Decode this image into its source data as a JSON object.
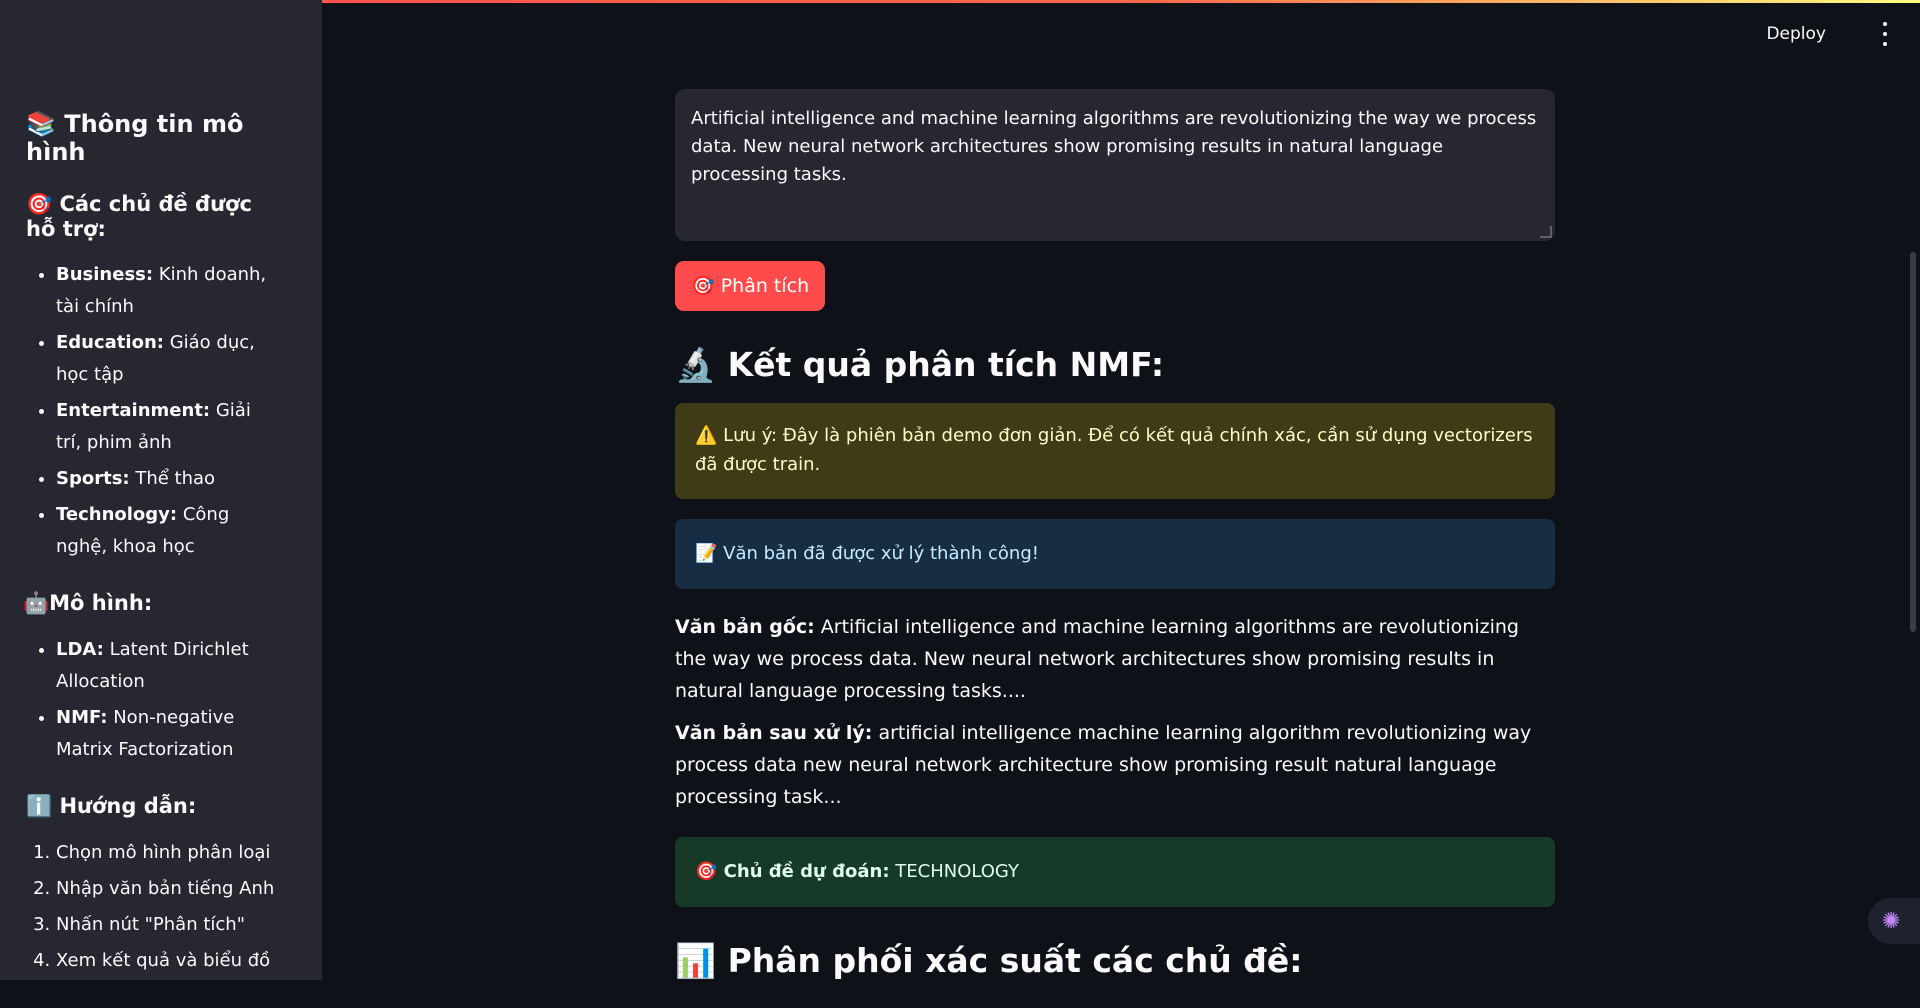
{
  "header": {
    "deploy_label": "Deploy"
  },
  "sidebar": {
    "info_title": "📚 Thông tin mô hình",
    "topics_title": "🎯 Các chủ đề được hỗ trợ:",
    "topics": [
      {
        "name": "Business:",
        "desc": " Kinh doanh, tài chính"
      },
      {
        "name": "Education:",
        "desc": " Giáo dục, học tập"
      },
      {
        "name": "Entertainment:",
        "desc": " Giải trí, phim ảnh"
      },
      {
        "name": "Sports:",
        "desc": " Thể thao"
      },
      {
        "name": "Technology:",
        "desc": " Công nghệ, khoa học"
      }
    ],
    "models_title": "🤖Mô hình:",
    "models": [
      {
        "name": "LDA:",
        "desc": " Latent Dirichlet Allocation"
      },
      {
        "name": "NMF:",
        "desc": " Non-negative Matrix Factorization"
      }
    ],
    "guide_title": "ℹ️ Hướng dẫn:",
    "guide": [
      "Chọn mô hình phân loại",
      "Nhập văn bản tiếng Anh",
      "Nhấn nút \"Phân tích\"",
      "Xem kết quả và biểu đồ"
    ]
  },
  "main": {
    "input_text": "Artificial intelligence and machine learning algorithms are revolutionizing the way we process data. New neural network architectures show promising results in natural language processing tasks.",
    "analyze_button": "🎯 Phân tích",
    "results_title": "🔬 Kết quả phân tích NMF:",
    "warning": "⚠️ Lưu ý: Đây là phiên bản demo đơn giản. Để có kết quả chính xác, cần sử dụng vectorizers đã được train.",
    "info": "📝 Văn bản đã được xử lý thành công!",
    "original_label": "Văn bản gốc:",
    "original_text": " Artificial intelligence and machine learning algorithms are revolutionizing the way we process data. New neural network architectures show promising results in natural language processing tasks....",
    "processed_label": "Văn bản sau xử lý:",
    "processed_text": " artificial intelligence machine learning algorithm revolutionizing way process data new neural network architecture show promising result natural language processing task...",
    "prediction_label": "🎯 Chủ đề dự đoán:",
    "prediction_value": " TECHNOLOGY",
    "distribution_title": "📊 Phân phối xác suất các chủ đề:"
  },
  "colors": {
    "background": "#0e1117",
    "sidebar": "#262730",
    "primary": "#ff4b4b",
    "warning_bg": "#3e3b16",
    "info_bg": "#172d43",
    "success_bg": "#173928"
  }
}
